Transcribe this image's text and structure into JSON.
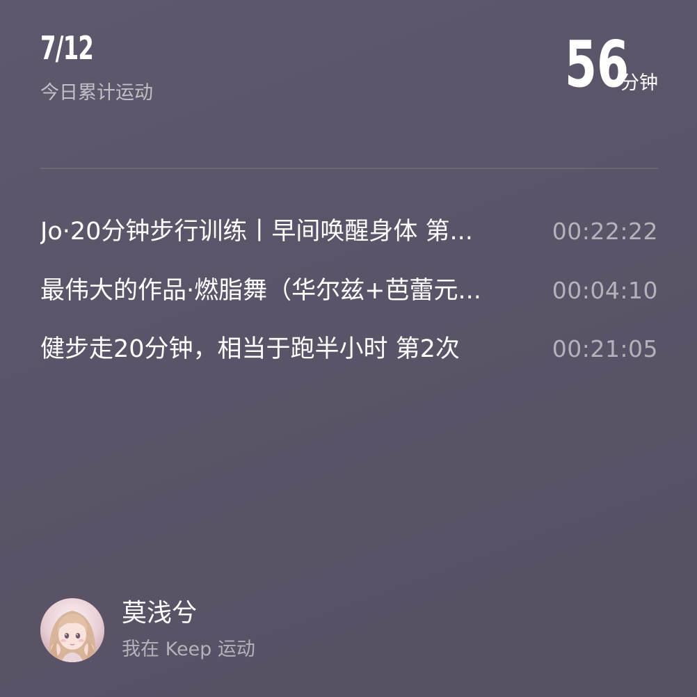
{
  "summary": {
    "date": "7/12",
    "date_caption": "今日累计运动",
    "total_value": "56",
    "total_unit": "分钟"
  },
  "activities": [
    {
      "title": "Jo·20分钟步行训练丨早间唤醒身体 第...",
      "duration": "00:22:22"
    },
    {
      "title": "最伟大的作品·燃脂舞（华尔兹+芭蕾元...",
      "duration": "00:04:10"
    },
    {
      "title": "健步走20分钟，相当于跑半小时 第2次",
      "duration": "00:21:05"
    }
  ],
  "user": {
    "name": "莫浅兮",
    "subtitle": "我在 Keep 运动",
    "avatar": "avatar-icon"
  },
  "colors": {
    "background": "#5b5468",
    "primary_text": "#ffffff",
    "secondary_text": "#b7b2c0"
  }
}
